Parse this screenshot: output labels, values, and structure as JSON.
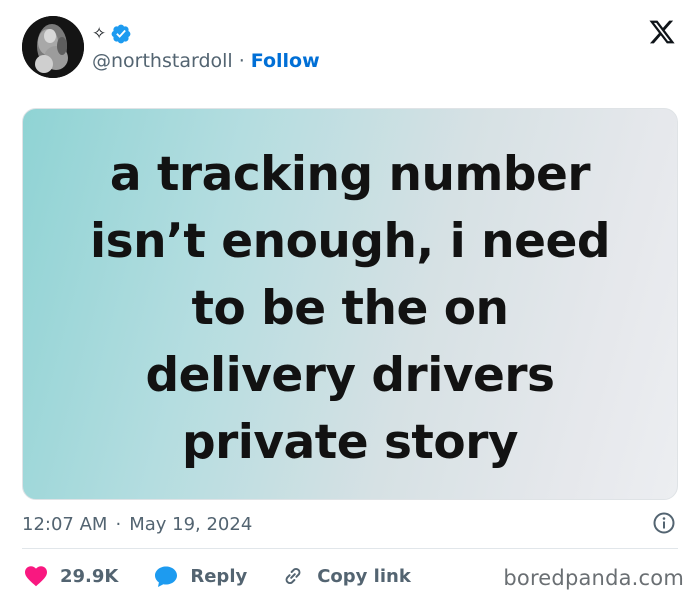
{
  "author": {
    "display_name_symbol": "✧",
    "handle": "@northstardoll",
    "separator": "·",
    "follow_label": "Follow",
    "verified_color": "#1d9bf0"
  },
  "post": {
    "image_text_lines": [
      "a tracking number",
      "isn’t enough, i need",
      "to be the on",
      "delivery drivers",
      "private story"
    ],
    "time": "12:07 AM",
    "meta_separator": "·",
    "date": "May 19, 2024"
  },
  "actions": {
    "likes": "29.9K",
    "reply_label": "Reply",
    "copy_link_label": "Copy link",
    "like_color": "#f91880",
    "reply_color": "#1d9bf0"
  },
  "watermark": "boredpanda.com",
  "icons": {
    "close": "x-logo-icon",
    "info": "info-icon",
    "heart": "heart-icon",
    "reply": "speech-bubble-icon",
    "link": "link-icon"
  }
}
